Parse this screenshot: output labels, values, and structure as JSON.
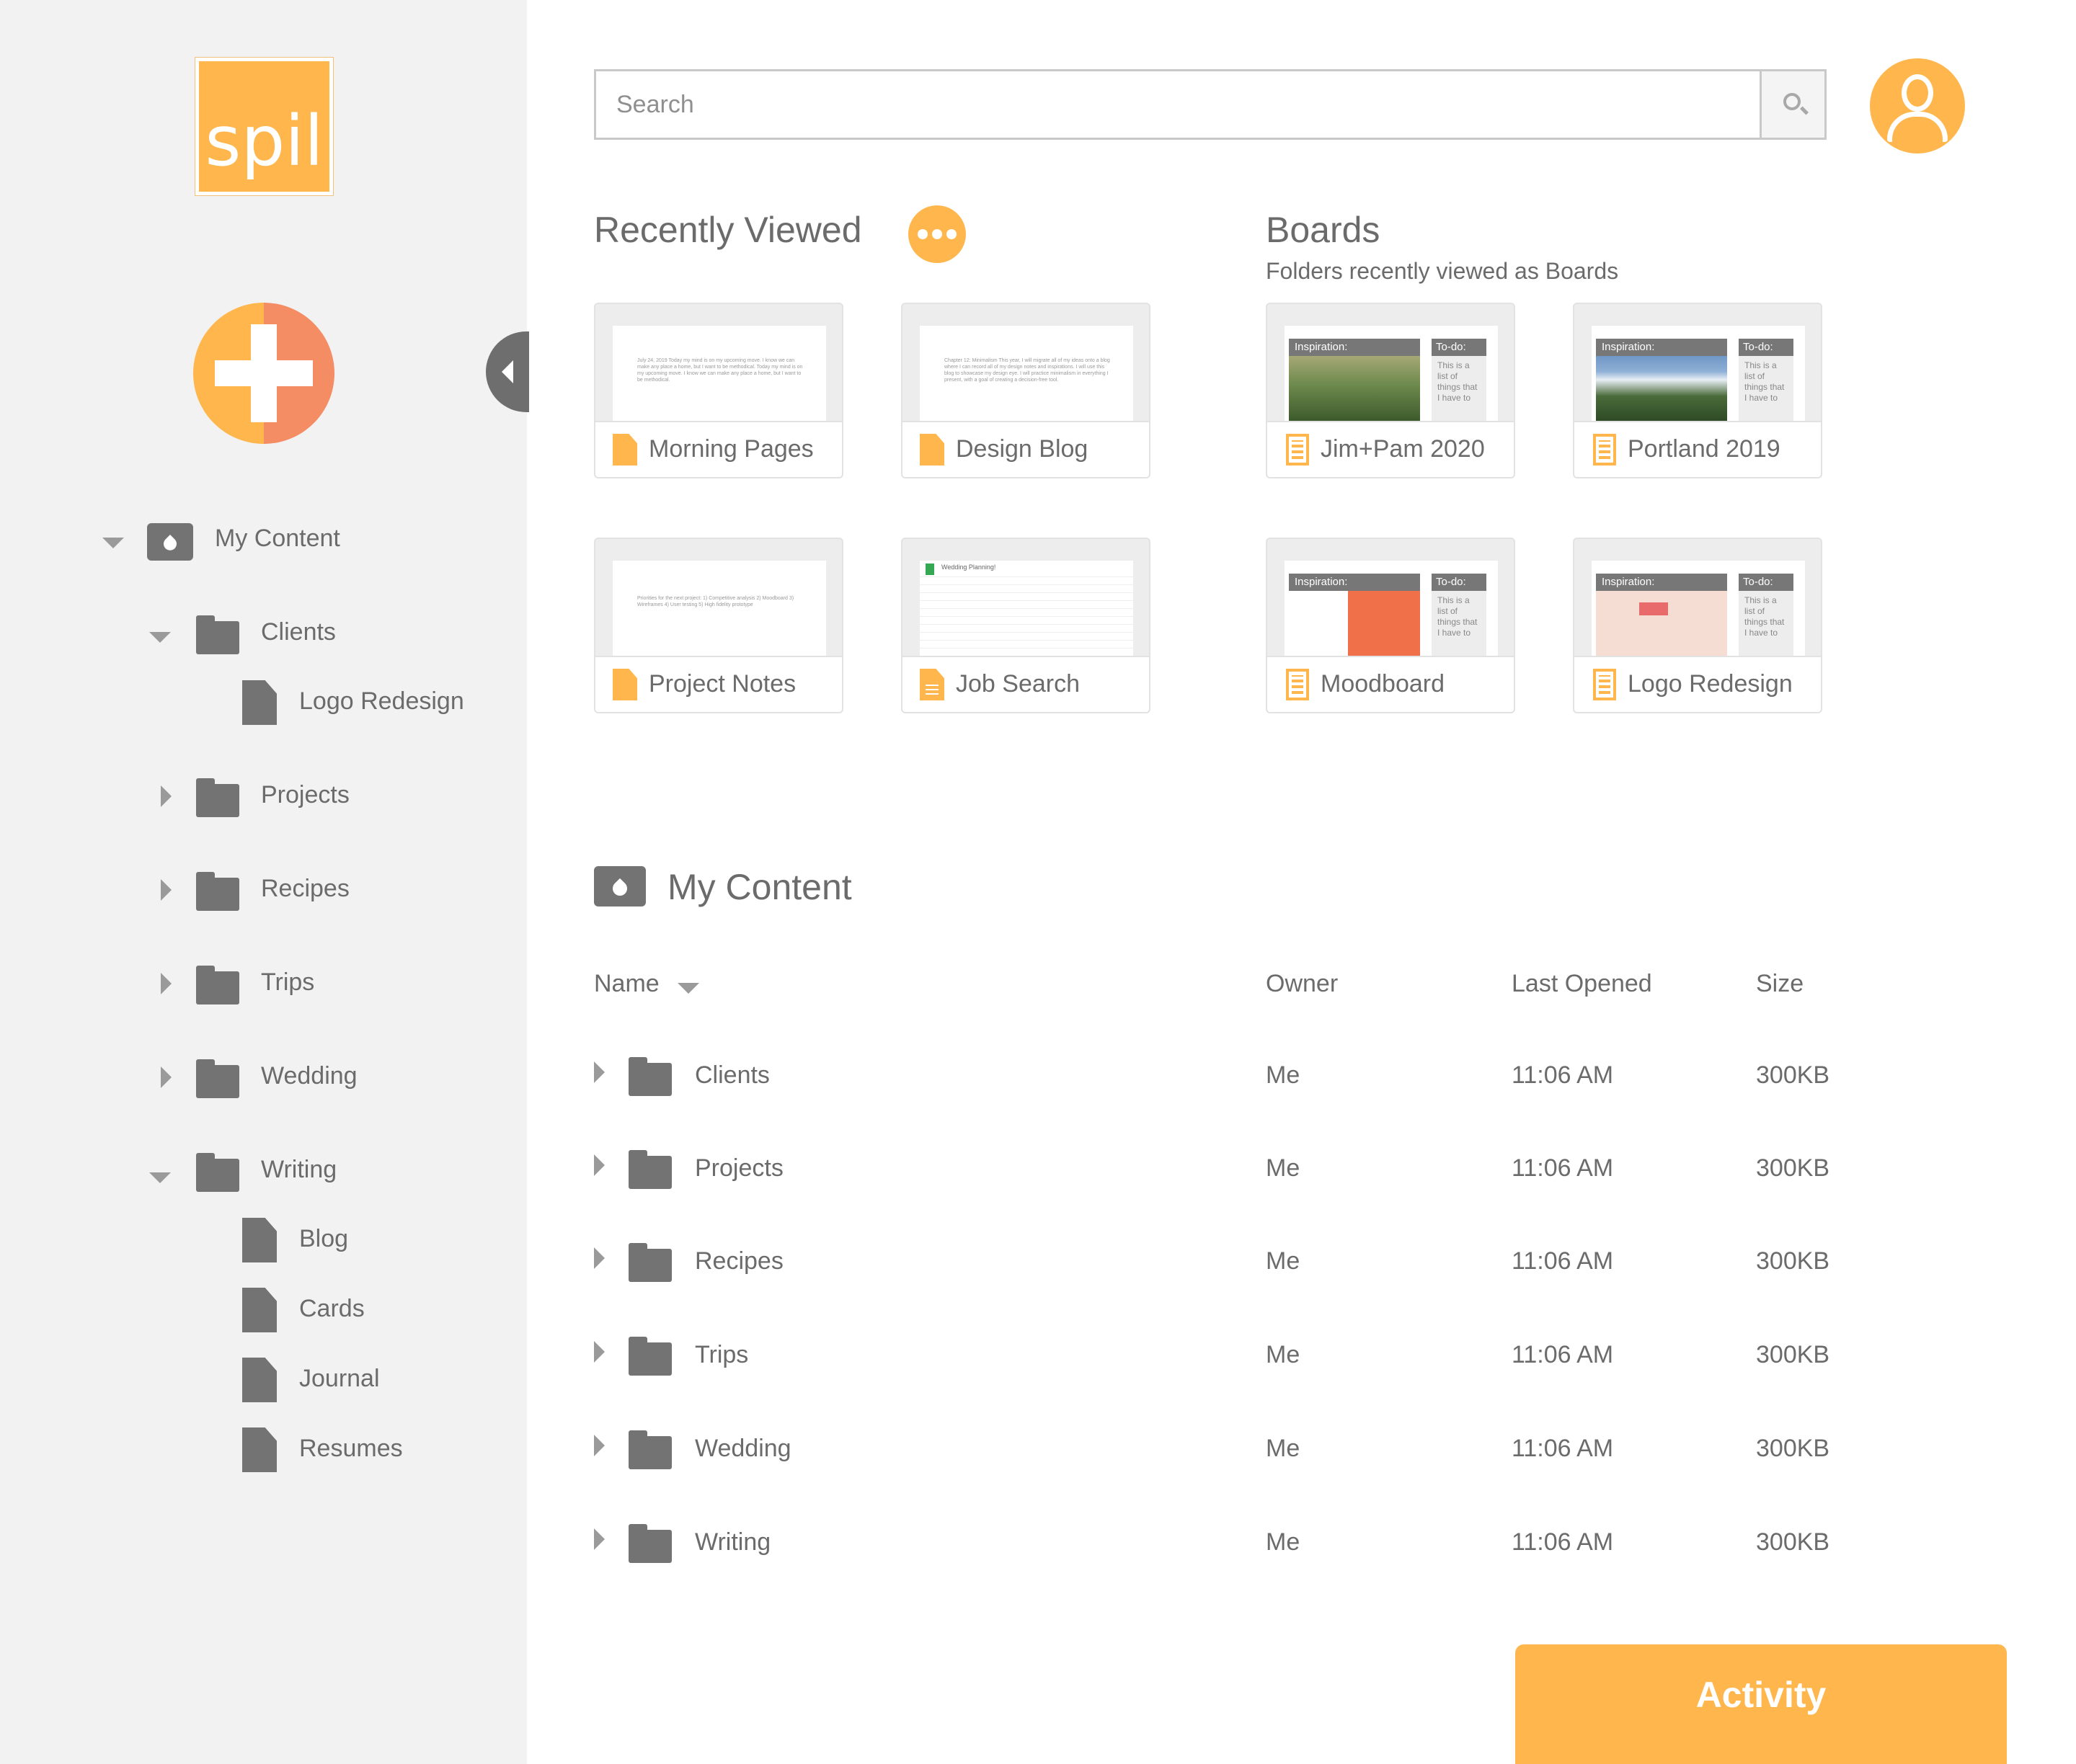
{
  "brand": {
    "logo_text": "spil",
    "accent": "#ffb74d",
    "accent_secondary": "#f48c64"
  },
  "sidebar": {
    "root": {
      "label": "My Content",
      "icon": "drop-icon",
      "expanded": true
    },
    "tree": [
      {
        "label": "Clients",
        "expanded": true,
        "children": [
          {
            "label": "Logo Redesign"
          }
        ]
      },
      {
        "label": "Projects",
        "expanded": false
      },
      {
        "label": "Recipes",
        "expanded": false
      },
      {
        "label": "Trips",
        "expanded": false
      },
      {
        "label": "Wedding",
        "expanded": false
      },
      {
        "label": "Writing",
        "expanded": true,
        "children": [
          {
            "label": "Blog"
          },
          {
            "label": "Cards"
          },
          {
            "label": "Journal"
          },
          {
            "label": "Resumes"
          }
        ]
      }
    ]
  },
  "search": {
    "placeholder": "Search"
  },
  "recently_viewed": {
    "title": "Recently Viewed",
    "cards": [
      {
        "label": "Morning Pages",
        "type": "doc",
        "preview": "July 24, 2019\n\nToday my mind is on my upcoming move. I know we can make any place a home, but I want to be methodical.\n\nToday my mind is on my upcoming move. I know we can make any place a home, but I want to be methodical."
      },
      {
        "label": "Design Blog",
        "type": "doc",
        "preview": "Chapter 12: Minimalism\n\nThis year, I will migrate all of my ideas onto a blog where I can record all of my design notes and inspirations. I will use this blog to showcase my design eye. I will practice minimalism in everything I present, with a goal of creating a decision-free tool."
      },
      {
        "label": "Project Notes",
        "type": "doc",
        "preview": "Priorities for the next project:\n\n1) Competitive analysis\n2) Moodboard\n3) Wireframes\n4) User testing\n5) High fidelity prototype"
      },
      {
        "label": "Job Search",
        "type": "sheet",
        "preview": "Wedding Planning!"
      }
    ]
  },
  "boards": {
    "title": "Boards",
    "subtitle": "Folders recently viewed as Boards",
    "inspiration_label": "Inspiration:",
    "todo_label": "To-do:",
    "todo_text": "This is a list of things that I have to",
    "cards": [
      {
        "label": "Jim+Pam 2020",
        "thumb_color": "#5d7a4a"
      },
      {
        "label": "Portland 2019",
        "thumb_color": "#3f6d9e"
      },
      {
        "label": "Moodboard",
        "thumb_color": "#f0704a"
      },
      {
        "label": "Logo Redesign",
        "thumb_color": "#f4d6cc"
      }
    ]
  },
  "my_content": {
    "title": "My Content",
    "columns": {
      "name": "Name",
      "owner": "Owner",
      "last_opened": "Last Opened",
      "size": "Size"
    },
    "rows": [
      {
        "name": "Clients",
        "owner": "Me",
        "last_opened": "11:06 AM",
        "size": "300KB"
      },
      {
        "name": "Projects",
        "owner": "Me",
        "last_opened": "11:06 AM",
        "size": "300KB"
      },
      {
        "name": "Recipes",
        "owner": "Me",
        "last_opened": "11:06 AM",
        "size": "300KB"
      },
      {
        "name": "Trips",
        "owner": "Me",
        "last_opened": "11:06 AM",
        "size": "300KB"
      },
      {
        "name": "Wedding",
        "owner": "Me",
        "last_opened": "11:06 AM",
        "size": "300KB"
      },
      {
        "name": "Writing",
        "owner": "Me",
        "last_opened": "11:06 AM",
        "size": "300KB"
      }
    ]
  },
  "activity": {
    "label": "Activity"
  }
}
